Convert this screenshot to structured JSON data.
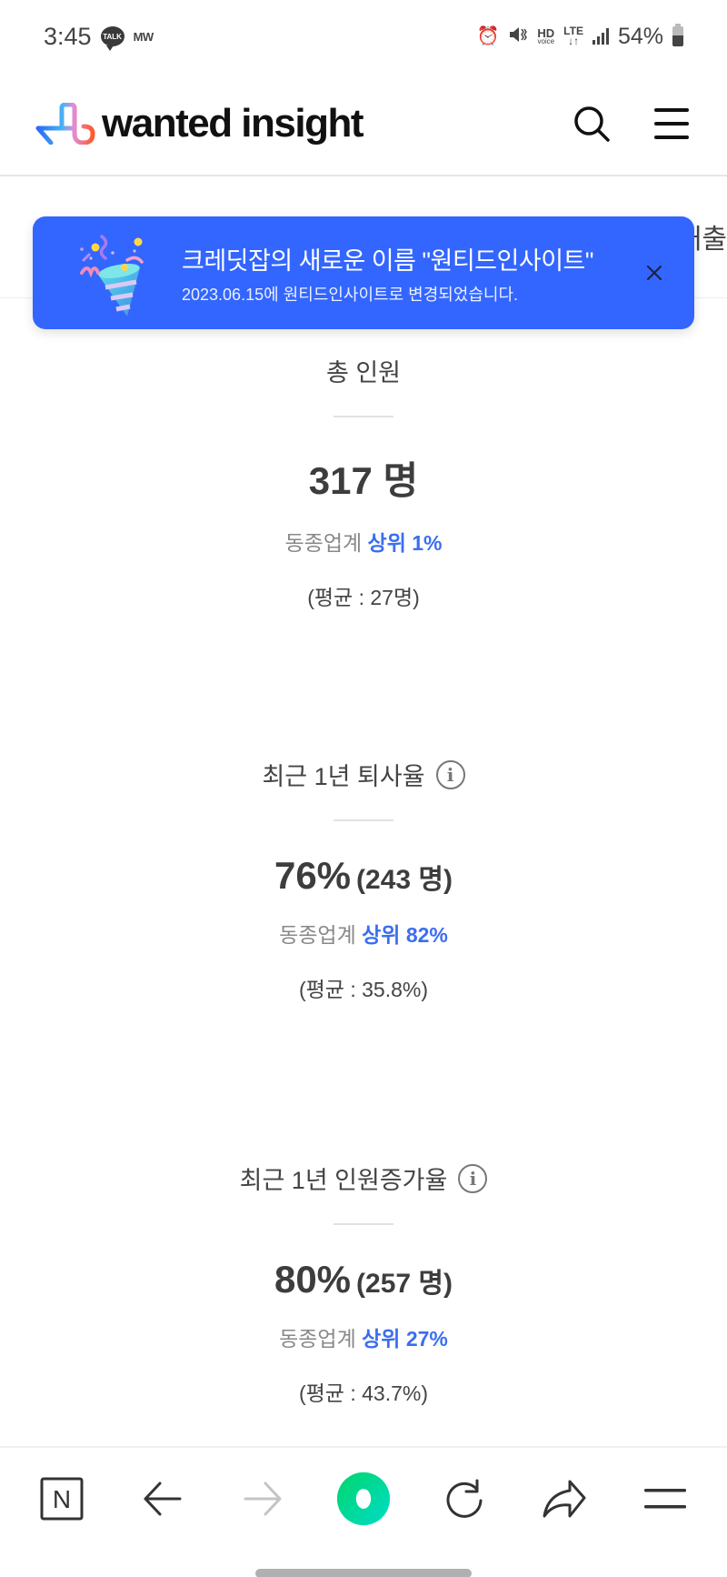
{
  "status_bar": {
    "time": "3:45",
    "notif_talk": "TALK",
    "notif_mw": "MW",
    "hd_label": "HD",
    "hd_sub": "voice",
    "lte_label": "LTE",
    "lte_arrows": "↓↑",
    "battery": "54%"
  },
  "header": {
    "brand": "wanted insight",
    "search_icon": "search-icon",
    "menu_icon": "hamburger-icon"
  },
  "tabs": {
    "peek_label": "매출"
  },
  "toast": {
    "title": "크레딧잡의 새로운 이름 \"원티드인사이트\"",
    "subtitle": "2023.06.15에 원티드인사이트로 변경되었습니다.",
    "close_label": "×"
  },
  "stats": [
    {
      "title": "총 인원",
      "has_info": false,
      "value": "317 명",
      "value_sub": "",
      "rank_prefix": "동종업계 ",
      "rank_value": "상위 1%",
      "average": "(평균 : 27명)"
    },
    {
      "title": "최근 1년 퇴사율",
      "has_info": true,
      "value": "76%",
      "value_sub": "(243 명)",
      "rank_prefix": "동종업계 ",
      "rank_value": "상위 82%",
      "average": "(평균 : 35.8%)"
    },
    {
      "title": "최근 1년 인원증가율",
      "has_info": true,
      "value": "80%",
      "value_sub": "(257 명)",
      "rank_prefix": "동종업계 ",
      "rank_value": "상위 27%",
      "average": "(평균 : 43.7%)"
    }
  ],
  "info_glyph": "i",
  "bottom_bar": {
    "n_label": "N",
    "items": [
      "naver-home",
      "back",
      "forward",
      "green-dot",
      "reload",
      "share",
      "menu"
    ]
  },
  "colors": {
    "toast_bg": "#3366ff",
    "highlight": "#3b6ef0",
    "green_start": "#00d66b",
    "green_end": "#00dcc8"
  }
}
